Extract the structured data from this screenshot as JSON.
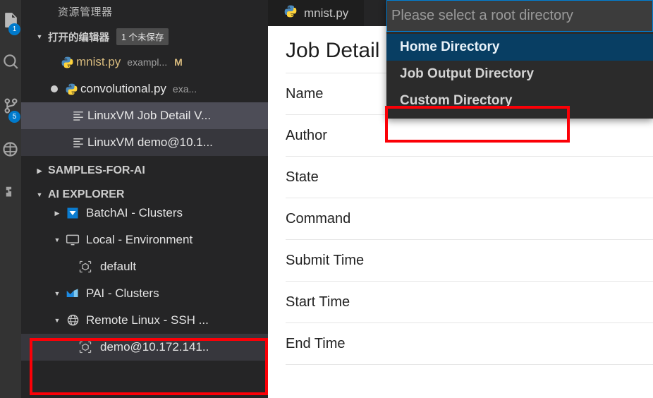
{
  "activity_bar": {
    "items": [
      {
        "name": "explorer-icon",
        "badge": "1"
      },
      {
        "name": "search-icon",
        "badge": ""
      },
      {
        "name": "source-control-icon",
        "badge": "5"
      },
      {
        "name": "debug-icon",
        "badge": ""
      },
      {
        "name": "extensions-icon",
        "badge": ""
      }
    ]
  },
  "sidebar": {
    "title": "资源管理器",
    "open_editors": {
      "label": "打开的编辑器",
      "badge": "1 个未保存",
      "items": [
        {
          "icon": "python-icon",
          "name": "mnist.py",
          "desc": "exampl...",
          "status": "M",
          "dirty": false,
          "state": ""
        },
        {
          "icon": "python-icon",
          "name": "convolutional.py",
          "desc": "exa...",
          "status": "",
          "dirty": true,
          "state": ""
        },
        {
          "icon": "preview-icon",
          "name": "LinuxVM Job Detail V...",
          "desc": "",
          "status": "",
          "dirty": false,
          "state": "focused"
        },
        {
          "icon": "preview-icon",
          "name": "LinuxVM demo@10.1...",
          "desc": "",
          "status": "",
          "dirty": false,
          "state": "selected"
        }
      ]
    },
    "samples_section": {
      "label": "SAMPLES-FOR-AI",
      "expanded": false
    },
    "ai_explorer_section": {
      "label": "AI EXPLORER",
      "expanded": true
    },
    "tree": [
      {
        "label": "BatchAI - Clusters",
        "icon": "batchai-icon",
        "twisty": "collapsed",
        "indent": 1,
        "selected": false,
        "clipped": true
      },
      {
        "label": "Local - Environment",
        "icon": "monitor-icon",
        "twisty": "expanded",
        "indent": 1,
        "selected": false,
        "clipped": false
      },
      {
        "label": "default",
        "icon": "cube-icon",
        "twisty": "none",
        "indent": 2,
        "selected": false,
        "clipped": false
      },
      {
        "label": "PAI - Clusters",
        "icon": "pai-icon",
        "twisty": "expanded",
        "indent": 1,
        "selected": false,
        "clipped": false
      },
      {
        "label": "Remote Linux - SSH ...",
        "icon": "globe-icon",
        "twisty": "expanded",
        "indent": 1,
        "selected": false,
        "clipped": false
      },
      {
        "label": "demo@10.172.141..",
        "icon": "cube-icon",
        "twisty": "none",
        "indent": 2,
        "selected": true,
        "clipped": false
      }
    ]
  },
  "tabs": [
    {
      "label": "mnist.py",
      "icon": "python-icon",
      "active": true
    }
  ],
  "editor": {
    "title": "Job Detail",
    "fields": [
      {
        "label": "Name",
        "value": ""
      },
      {
        "label": "Author",
        "value": ""
      },
      {
        "label": "State",
        "value": ""
      },
      {
        "label": "Command",
        "value": ""
      },
      {
        "label": "Submit Time",
        "value": ""
      },
      {
        "label": "Start Time",
        "value": ""
      },
      {
        "label": "End Time",
        "value": ""
      }
    ]
  },
  "quick_pick": {
    "input_value": "",
    "placeholder": "Please select a root directory",
    "options": [
      {
        "label": "Home Directory",
        "active": true
      },
      {
        "label": "Job Output Directory",
        "active": false
      },
      {
        "label": "Custom Directory",
        "active": false
      }
    ]
  },
  "annotations": {
    "highlight_color": "#fb0007",
    "boxes": [
      {
        "name": "custom-directory-highlight",
        "target": "Custom Directory"
      },
      {
        "name": "remote-linux-ssh-highlight",
        "target": "Remote Linux - SSH ... / demo@10.172.141.."
      }
    ]
  }
}
